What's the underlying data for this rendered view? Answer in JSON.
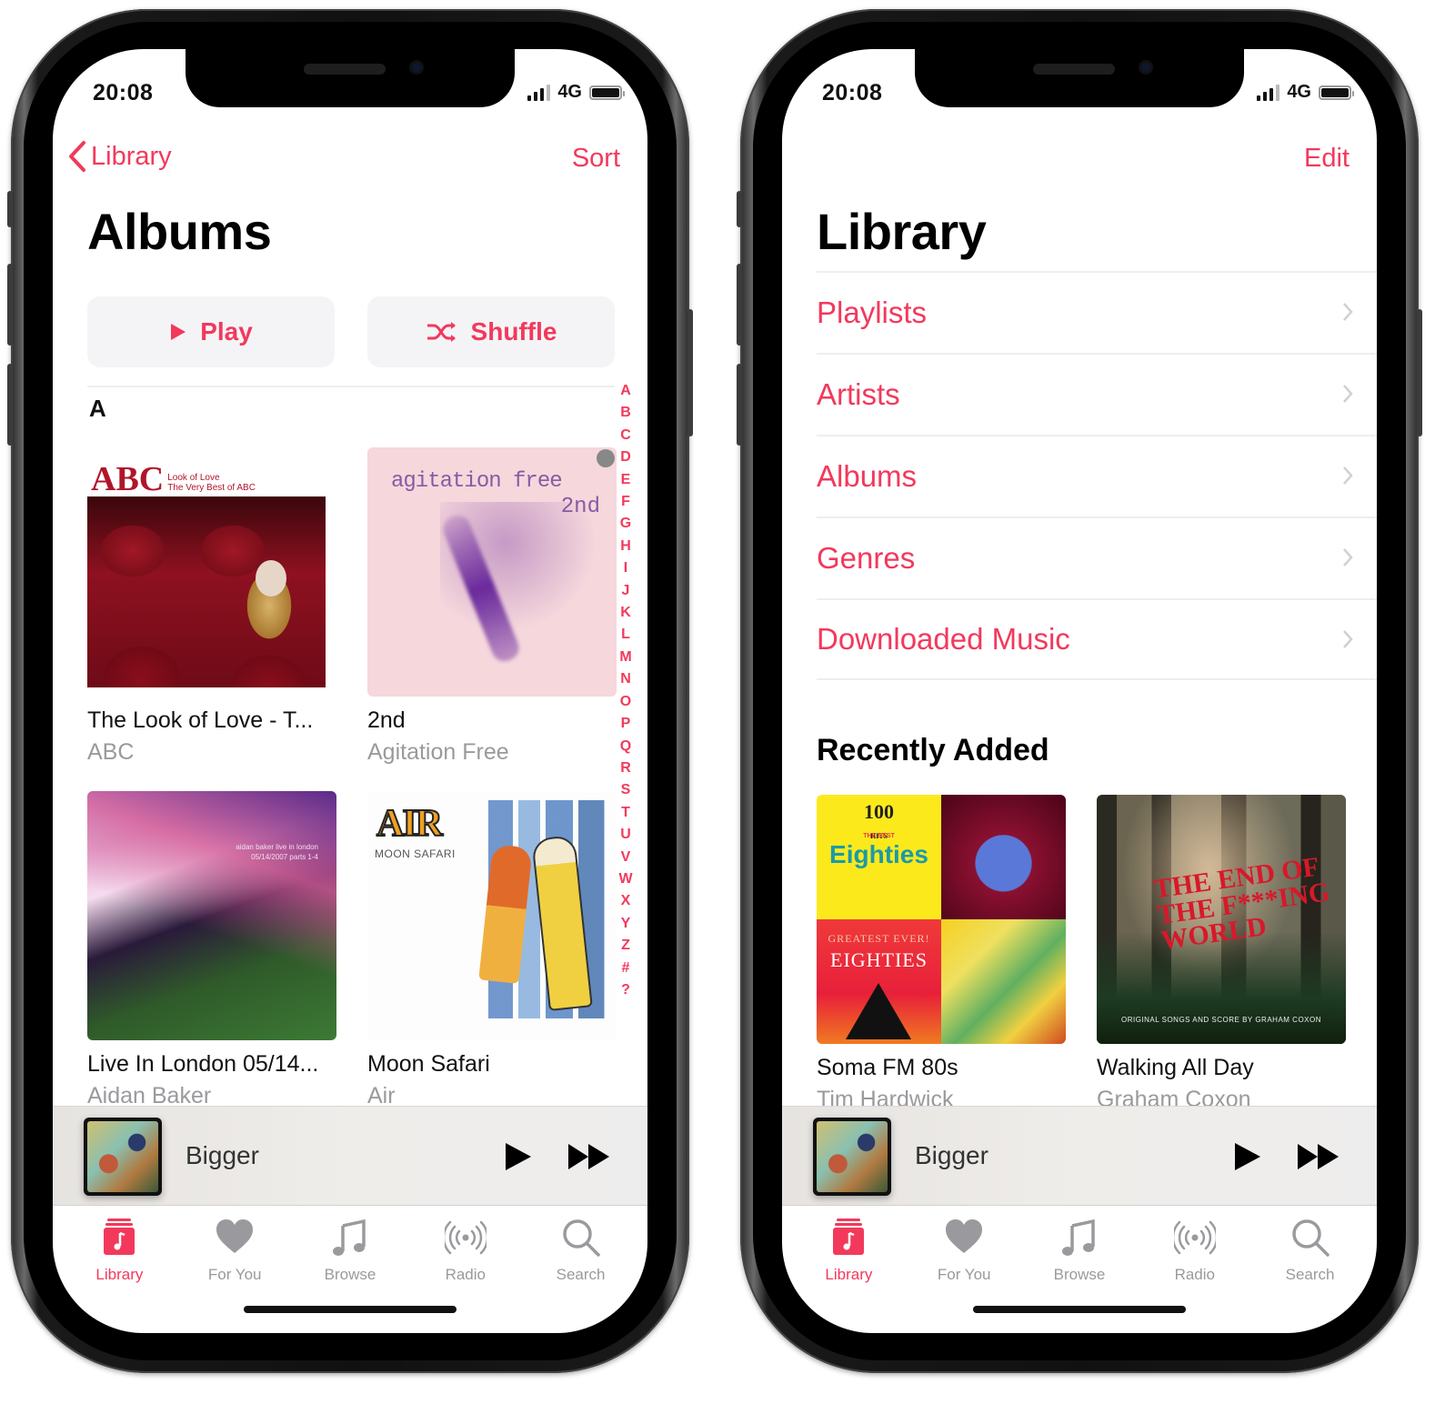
{
  "theme": {
    "accent": "#f2395c",
    "secondary_text": "#9a9a9e"
  },
  "status_bar": {
    "time": "20:08",
    "network": "4G",
    "signal_bars": 3,
    "battery_level": 1.0
  },
  "left_screen": {
    "nav": {
      "back_label": "Library",
      "right_button": "Sort"
    },
    "title": "Albums",
    "actions": {
      "play": "Play",
      "shuffle": "Shuffle"
    },
    "section_header": "A",
    "alpha_index": [
      "A",
      "B",
      "C",
      "D",
      "E",
      "F",
      "G",
      "H",
      "I",
      "J",
      "K",
      "L",
      "M",
      "N",
      "O",
      "P",
      "Q",
      "R",
      "S",
      "T",
      "U",
      "V",
      "W",
      "X",
      "Y",
      "Z",
      "#",
      "?"
    ],
    "albums": [
      {
        "title": "The Look of Love - T...",
        "artist": "ABC",
        "art": {
          "line1": "ABC",
          "line2": "Look of Love",
          "line3": "The Very Best of ABC"
        }
      },
      {
        "title": "2nd",
        "artist": "Agitation Free",
        "art": {
          "line1": "agitation free",
          "line2": "2nd"
        }
      },
      {
        "title": "Live In London 05/14...",
        "artist": "Aidan Baker",
        "art": {
          "line1": "aidan baker live in london",
          "line2": "05/14/2007 parts 1-4"
        }
      },
      {
        "title": "Moon Safari",
        "artist": "Air",
        "art": {
          "line1": "AIR",
          "line2": "MOON SAFARI"
        }
      }
    ]
  },
  "right_screen": {
    "nav": {
      "right_button": "Edit"
    },
    "title": "Library",
    "menu": [
      {
        "label": "Playlists"
      },
      {
        "label": "Artists"
      },
      {
        "label": "Albums"
      },
      {
        "label": "Genres"
      },
      {
        "label": "Downloaded Music"
      }
    ],
    "section_title": "Recently Added",
    "recent": [
      {
        "title": "Soma FM 80s",
        "artist": "Tim Hardwick",
        "art": {
          "a_top": "100",
          "a_sub": "HITS",
          "a_tag": "THE BEST",
          "a_main": "Eighties",
          "c_top": "GREATEST EVER!",
          "c_main": "EIGHTIES"
        }
      },
      {
        "title": "Walking All Day",
        "artist": "Graham Coxon",
        "art": {
          "headline": "THE END OF THE F***ING WORLD",
          "caption": "ORIGINAL SONGS AND SCORE BY GRAHAM COXON"
        }
      }
    ]
  },
  "mini_player": {
    "track": "Bigger"
  },
  "tab_bar": {
    "tabs": [
      {
        "label": "Library",
        "icon": "library-icon",
        "active": true
      },
      {
        "label": "For You",
        "icon": "heart-icon",
        "active": false
      },
      {
        "label": "Browse",
        "icon": "music-note-icon",
        "active": false
      },
      {
        "label": "Radio",
        "icon": "radio-icon",
        "active": false
      },
      {
        "label": "Search",
        "icon": "search-icon",
        "active": false
      }
    ]
  }
}
